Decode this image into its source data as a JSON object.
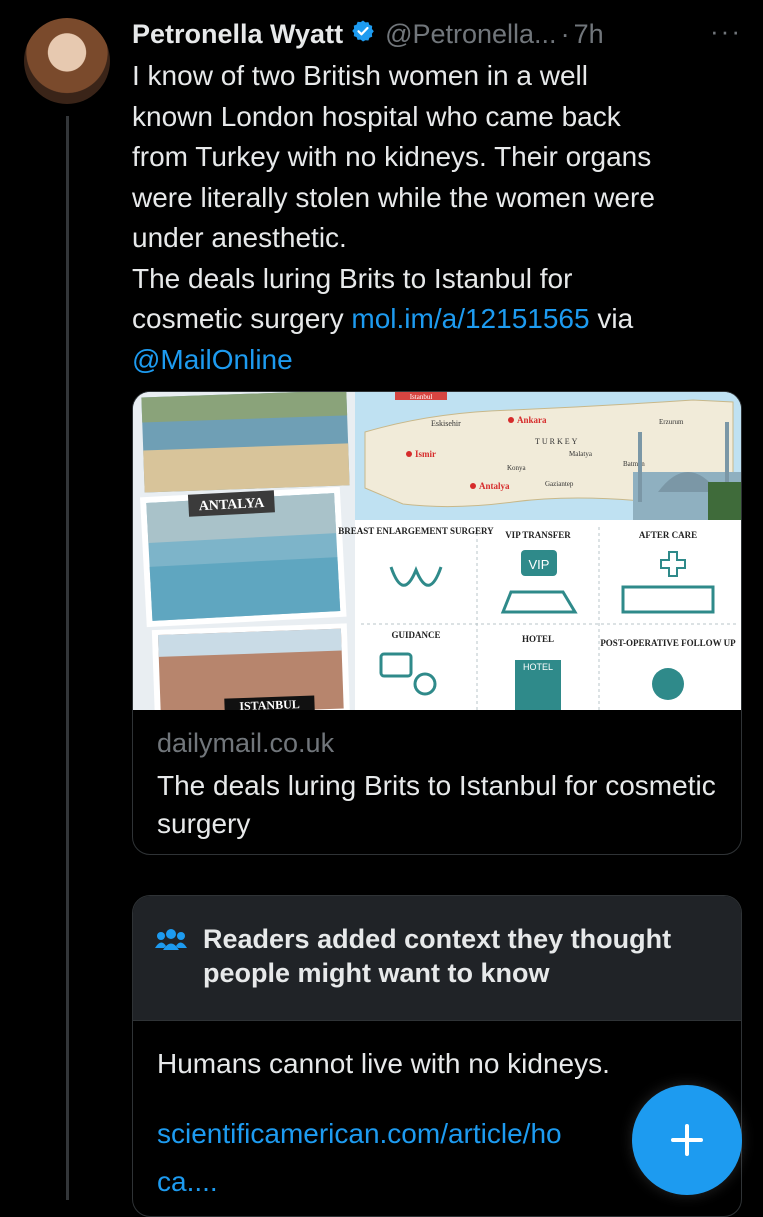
{
  "tweet": {
    "author_name": "Petronella Wyatt",
    "handle": "@Petronella...",
    "separator": "·",
    "time": "7h",
    "more": "···",
    "text_lines": [
      "I know of two British women in a well",
      "known London hospital who came back",
      "from Turkey with no kidneys. Their organs",
      "were literally stolen while the women were",
      "under anesthetic.",
      "The deals luring Brits to Istanbul for"
    ],
    "text_tail": "cosmetic surgery ",
    "link_url": "mol.im/a/12151565",
    "text_via": " via",
    "mention": "@MailOnline"
  },
  "card": {
    "domain": "dailymail.co.uk",
    "title": "The deals luring Brits to Istanbul for cosmetic surgery",
    "image": {
      "antalya_label": "ANTALYA",
      "istanbul_label": "Istanbul",
      "bottom_label": "ISTANBUL",
      "map_cities": [
        "Eskisehir",
        "Ankara",
        "Ismir",
        "TURKEY",
        "Malatya",
        "Konya",
        "Erzurum",
        "Batman",
        "Gaziantep",
        "Antalya"
      ],
      "panels": [
        "BREAST ENLARGEMENT SURGERY",
        "VIP TRANSFER",
        "AFTER CARE",
        "GUIDANCE",
        "HOTEL",
        "POST-OPERATIVE FOLLOW UP"
      ],
      "vip_text": "VIP",
      "hotel_sign": "HOTEL"
    }
  },
  "community_note": {
    "title": "Readers added context they thought people might want to know",
    "body": "Humans cannot live with no kidneys.",
    "link_line1": "scientificamerican.com/article/ho",
    "link_line2": "ca...."
  },
  "compose_button": {
    "icon": "plus-icon"
  },
  "colors": {
    "accent": "#1d9bf0",
    "background": "#000000",
    "muted": "#71767b",
    "note_header": "#202327"
  }
}
